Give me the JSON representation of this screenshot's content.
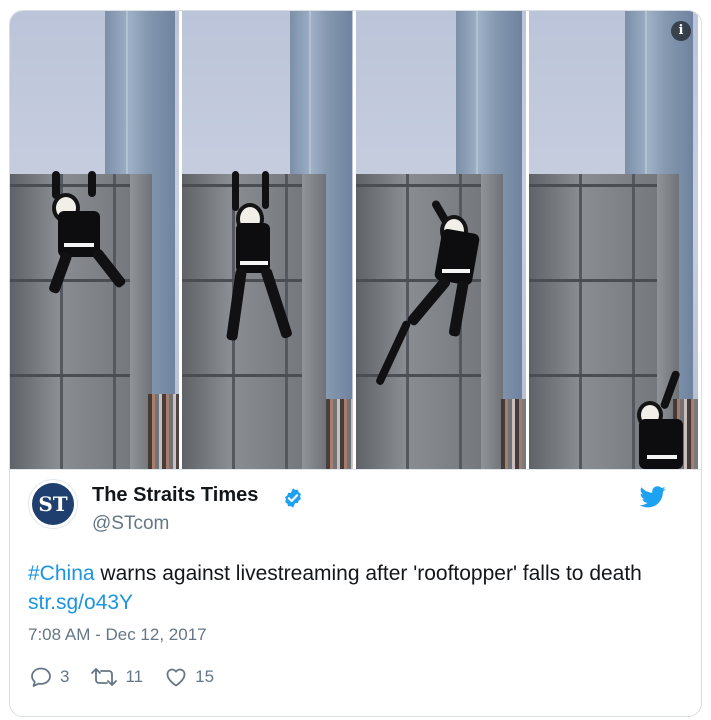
{
  "media": {
    "info_icon": "info-icon",
    "info_glyph": "i"
  },
  "author": {
    "avatar_text": "ST",
    "name": "The Straits Times",
    "handle": "@STcom",
    "verified_icon": "verified-badge-icon"
  },
  "brand_icon": "twitter-bird-icon",
  "tweet": {
    "hashtag": "#China",
    "text": " warns against livestreaming after 'rooftopper' falls to death ",
    "link": "str.sg/o43Y",
    "timestamp": "7:08 AM - Dec 12, 2017"
  },
  "actions": {
    "reply_count": "3",
    "retweet_count": "11",
    "like_count": "15"
  },
  "colors": {
    "link": "#1b95e0",
    "verified": "#1da1f2",
    "secondary_text": "#657786",
    "primary_text": "#14171a",
    "like": "#657786"
  }
}
